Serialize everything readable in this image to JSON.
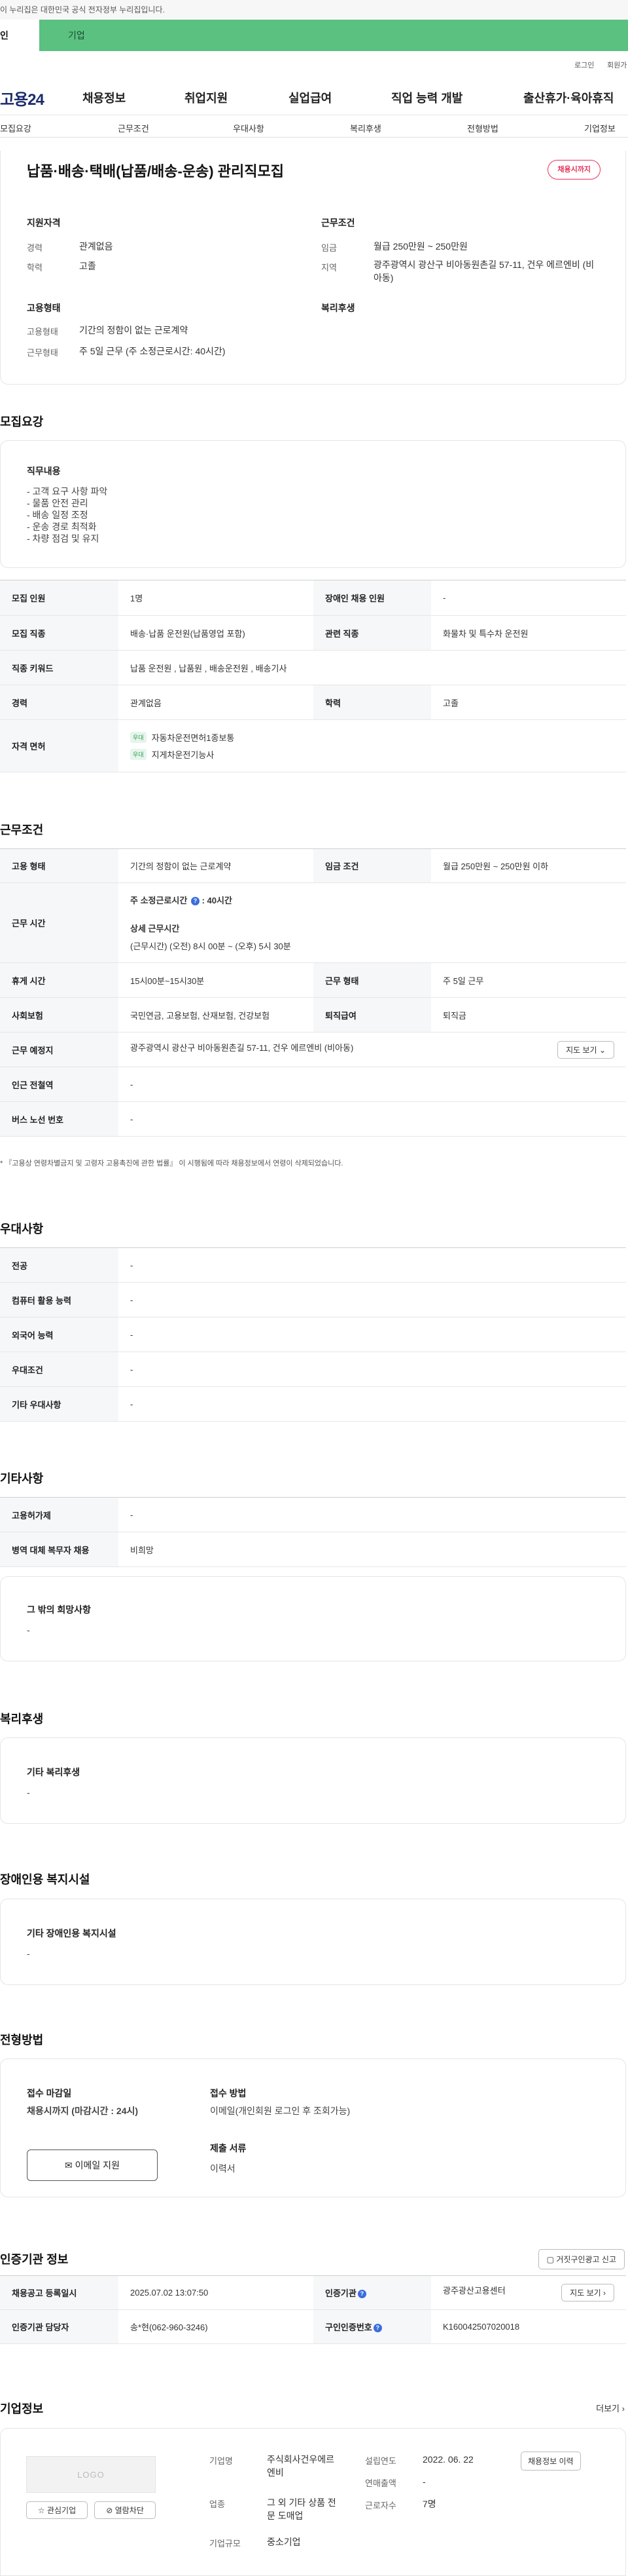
{
  "top_notice": "이 누리집은 대한민국 공식 전자정부 누리집입니다.",
  "top_bar": {
    "tab_a": "인",
    "tab_b": "기업"
  },
  "util": {
    "login": "로그인",
    "join": "회원가"
  },
  "gnb": {
    "logo": "고용24",
    "menu": [
      "채용정보",
      "취업지원",
      "실업급여",
      "직업 능력 개발",
      "출산휴가·육아휴직"
    ]
  },
  "subnav": [
    "모집요강",
    "근무조건",
    "우대사항",
    "복리후생",
    "전형방법",
    "기업정보"
  ],
  "summary": {
    "title": "납품·배송·택배(납품/배송-운송) 관리직모집",
    "status": "채용시까지",
    "qual_label": "지원자격",
    "career_k": "경력",
    "career_v": "관계없음",
    "edu_k": "학력",
    "edu_v": "고졸",
    "cond_label": "근무조건",
    "wage_k": "임금",
    "wage_v": "월급 250만원 ~ 250만원",
    "area_k": "지역",
    "area_v": "광주광역시 광산구 비아동원촌길 57-11, 건우 에르엔비 (비아동)",
    "emp_label": "고용형태",
    "emptype_k": "고용형태",
    "emptype_v": "기간의 정함이 없는 근로계약",
    "worktype_k": "근무형태",
    "worktype_v": "주 5일 근무 (주 소정근로시간: 40시간)",
    "welfare_label": "복리후생"
  },
  "recruit": {
    "title": "모집요강",
    "duty_label": "직무내용",
    "duties": [
      "- 고객 요구 사항 파악",
      "- 물품 안전 관리",
      "- 배송 일정 조정",
      "- 운송 경로 최적화",
      "- 차량 점검 및 유지"
    ],
    "rows": {
      "headcount_k": "모집 인원",
      "headcount_v": "1명",
      "disabled_k": "장애인 채용 인원",
      "disabled_v": "-",
      "job_k": "모집 직종",
      "job_v": "배송·납품 운전원(납품영업 포함)",
      "related_k": "관련 직종",
      "related_v": "화물차 및 특수차 운전원",
      "keyword_k": "직종 키워드",
      "keyword_v": "납품 운전원 , 납품원 , 배송운전원 , 배송기사",
      "career_k": "경력",
      "career_v": "관계없음",
      "edu_k": "학력",
      "edu_v": "고졸",
      "license_k": "자격 면허",
      "licenses": [
        {
          "tag": "우대",
          "name": "자동차운전면허1종보통"
        },
        {
          "tag": "우대",
          "name": "지게차운전기능사"
        }
      ]
    }
  },
  "conditions": {
    "title": "근무조건",
    "emp_k": "고용 형태",
    "emp_v": "기간의 정함이 없는 근로계약",
    "wage_k": "임금 조건",
    "wage_v": "월급 250만원 ~ 250만원 이하",
    "hours_k": "근무 시간",
    "hours_line1_a": "주 소정근로시간",
    "hours_line1_b": ": 40시간",
    "hours_detail_label": "상세 근무시간",
    "hours_detail": "(근무시간) (오전) 8시 00분 ~ (오후) 5시 30분",
    "break_k": "휴게 시간",
    "break_v": "15시00분~15시30분",
    "worktype_k": "근무 형태",
    "worktype_v": "주 5일 근무",
    "insurance_k": "사회보험",
    "insurance_v": "국민연금, 고용보험, 산재보험, 건강보험",
    "retire_k": "퇴직급여",
    "retire_v": "퇴직금",
    "place_k": "근무 예정지",
    "place_v": "광주광역시 광산구 비아동원촌길 57-11, 건우 에르엔비 (비아동)",
    "map_btn": "지도 보기",
    "subway_k": "인근 전철역",
    "subway_v": "-",
    "bus_k": "버스 노선 번호",
    "bus_v": "-",
    "note": "* 『고용상 연령차별금지 및 고령자 고용촉진에 관한 법률』 이 시행됨에 따라 채용정보에서 연령이 삭제되었습니다."
  },
  "preference": {
    "title": "우대사항",
    "rows": [
      {
        "k": "전공",
        "v": "-"
      },
      {
        "k": "컴퓨터 활용 능력",
        "v": "-"
      },
      {
        "k": "외국어 능력",
        "v": "-"
      },
      {
        "k": "우대조건",
        "v": "-"
      },
      {
        "k": "기타 우대사항",
        "v": "-"
      }
    ]
  },
  "etc": {
    "title": "기타사항",
    "rows": [
      {
        "k": "고용허가제",
        "v": "-"
      },
      {
        "k": "병역 대체 복무자 채용",
        "v": "비희망"
      }
    ],
    "other_label": "그 밖의 희망사항",
    "other_v": "-"
  },
  "welfare": {
    "title": "복리후생",
    "label": "기타 복리후생",
    "v": "-"
  },
  "disabled_fac": {
    "title": "장애인용 복지시설",
    "label": "기타 장애인용 복지시설",
    "v": "-"
  },
  "screening": {
    "title": "전형방법",
    "deadline_label": "접수 마감일",
    "deadline_v": "채용시까지 (마감시간 : 24시)",
    "email_btn": "이메일 지원",
    "method_label": "접수 방법",
    "method_v": "이메일(개인회원 로그인 후 조회가능)",
    "docs_label": "제출 서류",
    "docs_v": "이력서"
  },
  "agency": {
    "title": "인증기관 정보",
    "report_btn": "거짓구인광고 신고",
    "reg_k": "채용공고 등록일시",
    "reg_v": "2025.07.02 13:07:50",
    "agency_k": "인증기관",
    "agency_v": "광주광산고용센터",
    "map_btn": "지도 보기",
    "manager_k": "인증기관 담당자",
    "manager_v": "송*현(062-960-3246)",
    "num_k": "구인인증번호",
    "num_v": "K160042507020018"
  },
  "company": {
    "title": "기업정보",
    "more": "더보기",
    "logo": "LOGO",
    "fav_btn": "관심기업",
    "block_btn": "열람차단",
    "name_k": "기업명",
    "name_v": "주식회사건우에르엔비",
    "industry_k": "업종",
    "industry_v": "그 외 기타 상품 전문 도매업",
    "scale_k": "기업규모",
    "scale_v": "중소기업",
    "founded_k": "설립연도",
    "founded_v": "2022. 06. 22",
    "revenue_k": "연매출액",
    "revenue_v": "-",
    "employees_k": "근로자수",
    "employees_v": "7명",
    "history_btn": "채용정보 이력"
  }
}
